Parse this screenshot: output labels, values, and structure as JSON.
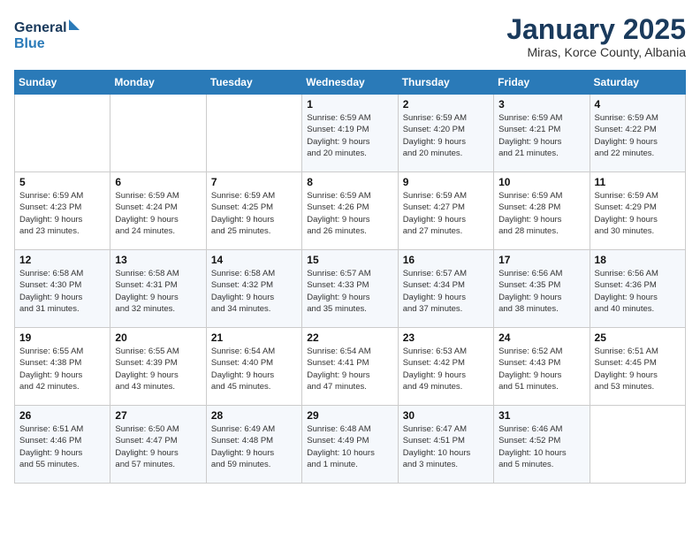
{
  "header": {
    "logo_line1": "General",
    "logo_line2": "Blue",
    "month_title": "January 2025",
    "location": "Miras, Korce County, Albania"
  },
  "days_of_week": [
    "Sunday",
    "Monday",
    "Tuesday",
    "Wednesday",
    "Thursday",
    "Friday",
    "Saturday"
  ],
  "weeks": [
    [
      {
        "day": "",
        "info": ""
      },
      {
        "day": "",
        "info": ""
      },
      {
        "day": "",
        "info": ""
      },
      {
        "day": "1",
        "info": "Sunrise: 6:59 AM\nSunset: 4:19 PM\nDaylight: 9 hours\nand 20 minutes."
      },
      {
        "day": "2",
        "info": "Sunrise: 6:59 AM\nSunset: 4:20 PM\nDaylight: 9 hours\nand 20 minutes."
      },
      {
        "day": "3",
        "info": "Sunrise: 6:59 AM\nSunset: 4:21 PM\nDaylight: 9 hours\nand 21 minutes."
      },
      {
        "day": "4",
        "info": "Sunrise: 6:59 AM\nSunset: 4:22 PM\nDaylight: 9 hours\nand 22 minutes."
      }
    ],
    [
      {
        "day": "5",
        "info": "Sunrise: 6:59 AM\nSunset: 4:23 PM\nDaylight: 9 hours\nand 23 minutes."
      },
      {
        "day": "6",
        "info": "Sunrise: 6:59 AM\nSunset: 4:24 PM\nDaylight: 9 hours\nand 24 minutes."
      },
      {
        "day": "7",
        "info": "Sunrise: 6:59 AM\nSunset: 4:25 PM\nDaylight: 9 hours\nand 25 minutes."
      },
      {
        "day": "8",
        "info": "Sunrise: 6:59 AM\nSunset: 4:26 PM\nDaylight: 9 hours\nand 26 minutes."
      },
      {
        "day": "9",
        "info": "Sunrise: 6:59 AM\nSunset: 4:27 PM\nDaylight: 9 hours\nand 27 minutes."
      },
      {
        "day": "10",
        "info": "Sunrise: 6:59 AM\nSunset: 4:28 PM\nDaylight: 9 hours\nand 28 minutes."
      },
      {
        "day": "11",
        "info": "Sunrise: 6:59 AM\nSunset: 4:29 PM\nDaylight: 9 hours\nand 30 minutes."
      }
    ],
    [
      {
        "day": "12",
        "info": "Sunrise: 6:58 AM\nSunset: 4:30 PM\nDaylight: 9 hours\nand 31 minutes."
      },
      {
        "day": "13",
        "info": "Sunrise: 6:58 AM\nSunset: 4:31 PM\nDaylight: 9 hours\nand 32 minutes."
      },
      {
        "day": "14",
        "info": "Sunrise: 6:58 AM\nSunset: 4:32 PM\nDaylight: 9 hours\nand 34 minutes."
      },
      {
        "day": "15",
        "info": "Sunrise: 6:57 AM\nSunset: 4:33 PM\nDaylight: 9 hours\nand 35 minutes."
      },
      {
        "day": "16",
        "info": "Sunrise: 6:57 AM\nSunset: 4:34 PM\nDaylight: 9 hours\nand 37 minutes."
      },
      {
        "day": "17",
        "info": "Sunrise: 6:56 AM\nSunset: 4:35 PM\nDaylight: 9 hours\nand 38 minutes."
      },
      {
        "day": "18",
        "info": "Sunrise: 6:56 AM\nSunset: 4:36 PM\nDaylight: 9 hours\nand 40 minutes."
      }
    ],
    [
      {
        "day": "19",
        "info": "Sunrise: 6:55 AM\nSunset: 4:38 PM\nDaylight: 9 hours\nand 42 minutes."
      },
      {
        "day": "20",
        "info": "Sunrise: 6:55 AM\nSunset: 4:39 PM\nDaylight: 9 hours\nand 43 minutes."
      },
      {
        "day": "21",
        "info": "Sunrise: 6:54 AM\nSunset: 4:40 PM\nDaylight: 9 hours\nand 45 minutes."
      },
      {
        "day": "22",
        "info": "Sunrise: 6:54 AM\nSunset: 4:41 PM\nDaylight: 9 hours\nand 47 minutes."
      },
      {
        "day": "23",
        "info": "Sunrise: 6:53 AM\nSunset: 4:42 PM\nDaylight: 9 hours\nand 49 minutes."
      },
      {
        "day": "24",
        "info": "Sunrise: 6:52 AM\nSunset: 4:43 PM\nDaylight: 9 hours\nand 51 minutes."
      },
      {
        "day": "25",
        "info": "Sunrise: 6:51 AM\nSunset: 4:45 PM\nDaylight: 9 hours\nand 53 minutes."
      }
    ],
    [
      {
        "day": "26",
        "info": "Sunrise: 6:51 AM\nSunset: 4:46 PM\nDaylight: 9 hours\nand 55 minutes."
      },
      {
        "day": "27",
        "info": "Sunrise: 6:50 AM\nSunset: 4:47 PM\nDaylight: 9 hours\nand 57 minutes."
      },
      {
        "day": "28",
        "info": "Sunrise: 6:49 AM\nSunset: 4:48 PM\nDaylight: 9 hours\nand 59 minutes."
      },
      {
        "day": "29",
        "info": "Sunrise: 6:48 AM\nSunset: 4:49 PM\nDaylight: 10 hours\nand 1 minute."
      },
      {
        "day": "30",
        "info": "Sunrise: 6:47 AM\nSunset: 4:51 PM\nDaylight: 10 hours\nand 3 minutes."
      },
      {
        "day": "31",
        "info": "Sunrise: 6:46 AM\nSunset: 4:52 PM\nDaylight: 10 hours\nand 5 minutes."
      },
      {
        "day": "",
        "info": ""
      }
    ]
  ]
}
